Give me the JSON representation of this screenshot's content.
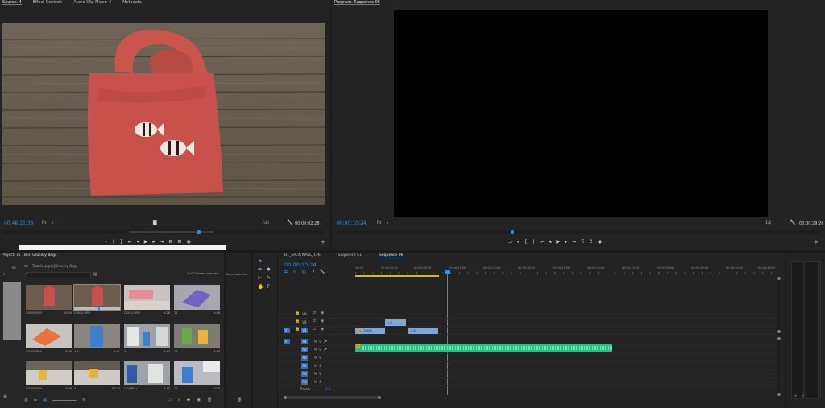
{
  "source_monitor": {
    "tabs": [
      "Source: 4",
      "Effect Controls",
      "Audio Clip Mixer: 4",
      "Metadata"
    ],
    "timecode": "00;46;21;36",
    "fit": "Fit",
    "quality": "Full",
    "duration": "00;00;02;28"
  },
  "program_monitor": {
    "tab": "Program: Sequence 06",
    "timecode": "00;00;10;24",
    "fit": "Fit",
    "scale": "1/2",
    "duration": "00;00;29;26"
  },
  "project_panel": {
    "tabs": [
      "Project: Tu",
      "Bin: Grocery Bags"
    ],
    "left_stub": "Tut",
    "path": "Tutorial.prproj\\Grocery Bags",
    "count": "1 of 12 items selected",
    "right_stub": "items selected",
    "items": [
      {
        "name": "C0009.MP4",
        "dur": "10:09"
      },
      {
        "name": "C0010.MP4",
        "dur": ""
      },
      {
        "name": "C0011.MP4",
        "dur": "9:28"
      },
      {
        "name": "11",
        "dur": "4:49"
      },
      {
        "name": "C0005.MP4",
        "dur": "6:08"
      },
      {
        "name": "4.6",
        "dur": "9:41"
      },
      {
        "name": "3",
        "dur": "6:17"
      },
      {
        "name": "14",
        "dur": "6:45"
      },
      {
        "name": "C0006.MP4",
        "dur": "5:06"
      },
      {
        "name": "5",
        "dur": "57:24"
      },
      {
        "name": "C.0(MP4)",
        "dur": "8:17"
      },
      {
        "name": "12",
        "dur": "6:09"
      }
    ]
  },
  "timeline": {
    "tabs": [
      "B1_5ACKIWALL_136",
      "Sequence 01",
      "Sequence 06"
    ],
    "timecode": "00;00;10;24",
    "ruler": [
      "00;00",
      "00;00;04;00",
      "00;00;08;00",
      "00;00;12;00",
      "00;00;16;00",
      "00;00;20;00",
      "00;00;24;00",
      "00;00;28;00",
      "00;00;32;00",
      "00;00;36;00",
      "00;00;40;00",
      "00;00;44;00",
      "00;00;48;00"
    ],
    "video_tracks": [
      "V3",
      "V2",
      "V1"
    ],
    "audio_tracks": [
      "A1",
      "A2",
      "A3",
      "A4",
      "A5",
      "A6"
    ],
    "master_label": "Master",
    "master_value": "0.0",
    "clip_v2": "4",
    "clip_v1a": "C0009",
    "clip_v1b": "4",
    "clip_a1": "fx"
  },
  "colors": {
    "accent": "#2d8ceb",
    "clip_video": "#7fa6d6",
    "clip_audio": "#2fb985",
    "playhead": "#3b8ee8",
    "work_area": "#d4b72a"
  }
}
